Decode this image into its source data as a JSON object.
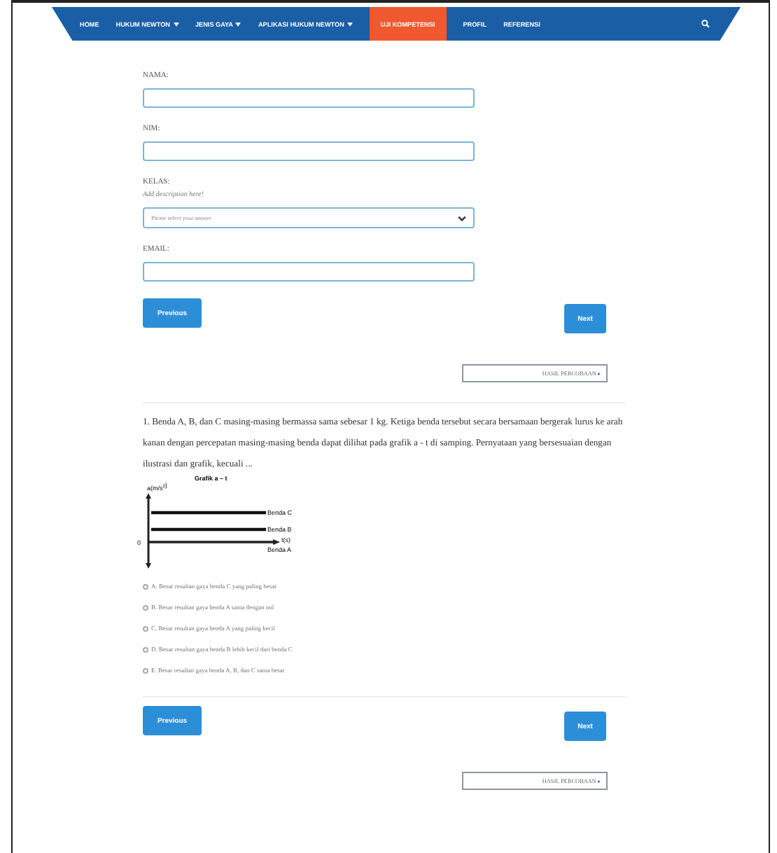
{
  "nav": {
    "items": [
      {
        "label": "HOME",
        "has_dropdown": false,
        "selected": false
      },
      {
        "label": "HUKUM NEWTON",
        "has_dropdown": true,
        "selected": false
      },
      {
        "label": "JENIS GAYA",
        "has_dropdown": true,
        "selected": false
      },
      {
        "label": "APLIKASI HUKUM NEWTON",
        "has_dropdown": true,
        "selected": false
      },
      {
        "label": "UJI KOMPETENSI",
        "has_dropdown": false,
        "selected": true
      },
      {
        "label": "PROFIL",
        "has_dropdown": false,
        "selected": false
      },
      {
        "label": "REFERENSI",
        "has_dropdown": false,
        "selected": false
      }
    ]
  },
  "form": {
    "fields": [
      {
        "kind": "text",
        "label": "NAMA:"
      },
      {
        "kind": "text",
        "label": "NIM:"
      },
      {
        "kind": "select",
        "label": "KELAS:",
        "description": "Add description here!",
        "placeholder": "Please select your answer"
      },
      {
        "kind": "text",
        "label": "EMAIL:"
      }
    ],
    "buttons": {
      "previous": "Previous",
      "next": "Next"
    },
    "results_button": "HASIL PERCOBAAN ▸"
  },
  "question": {
    "text": "1. Benda A, B, dan C masing-masing bermassa sama sebesar 1 kg. Ketiga benda tersebut secara bersamaan bergerak lurus ke arah kanan dengan percepatan masing-masing benda dapat dilihat pada grafik a - t di samping. Pernyataan yang bersesuaian dengan ilustrasi dan grafik, kecuali ...",
    "figure": {
      "title": "Grafik a – t",
      "y_axis": "a(m/s$^{2}$)",
      "origin": "0",
      "x_axis": "t(s)",
      "lines": [
        "Benda C",
        "Benda B",
        "Benda A"
      ]
    },
    "options": [
      {
        "label": "A. Besar resultan gaya benda C yang paling besar",
        "selected": false
      },
      {
        "label": "B. Besar resultan gaya benda A sama dengan nol",
        "selected": false
      },
      {
        "label": "C. Besar resultan gaya benda A yang paling kecil",
        "selected": false
      },
      {
        "label": "D. Besar resultan gaya benda B lebih kecil dari benda C",
        "selected": false
      },
      {
        "label": "E. Besar resultan gaya benda A, B, dan C sama besar",
        "selected": false
      }
    ],
    "buttons": {
      "previous": "Previous",
      "next": "Next"
    },
    "results_button": "HASIL PERCOBAAN ▸"
  }
}
